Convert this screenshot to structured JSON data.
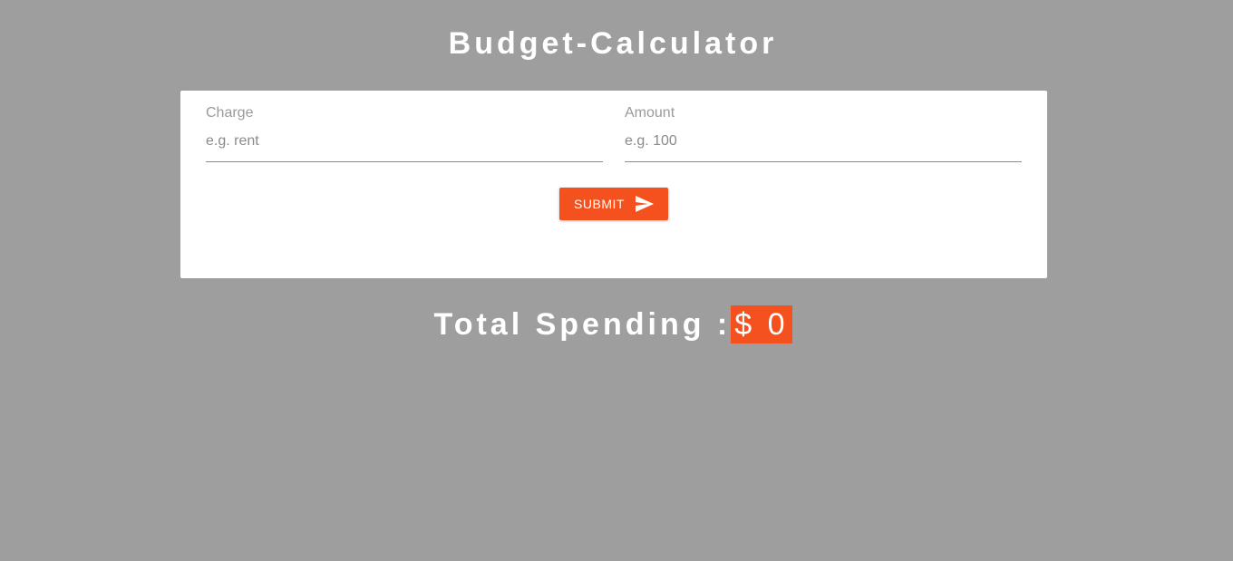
{
  "app": {
    "title": "Budget-Calculator"
  },
  "form": {
    "charge": {
      "label": "Charge",
      "value": "",
      "placeholder": "e.g. rent"
    },
    "amount": {
      "label": "Amount",
      "value": "",
      "placeholder": "e.g. 100"
    },
    "submit_label": "SUBMIT",
    "submit_icon": "send-icon"
  },
  "total": {
    "label": "Total Spending :",
    "amount": "$ 0"
  },
  "colors": {
    "background": "#9e9e9e",
    "accent": "#f4511e",
    "card": "#ffffff"
  }
}
